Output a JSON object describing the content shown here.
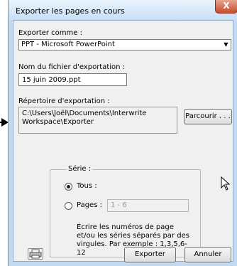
{
  "dialog": {
    "title": "Exporter les pages en cours",
    "close_label": "X"
  },
  "export_as": {
    "label": "Exporter comme :",
    "selected": "PPT - Microsoft PowerPoint"
  },
  "filename": {
    "label": "Nom du fichier d'exportation :",
    "value": "15 juin 2009.ppt"
  },
  "directory": {
    "label": "Répertoire d'exportation :",
    "value": "C:\\Users\\Joël\\Documents\\Interwrite\nWorkspace\\Exporter",
    "browse_label": "Parcourir . . ."
  },
  "series": {
    "group_label": "Série :",
    "all_label": "Tous :",
    "pages_label": "Pages :",
    "pages_value": "1 - 6",
    "help_text": "Écrire les numéros de page et/ou les séries séparés par des virgules. Par exemple : 1,3,5,6-12",
    "selected": "all"
  },
  "footer": {
    "export_label": "Exporter",
    "cancel_label": "Annuler"
  },
  "icons": {
    "printer": "printer-icon",
    "dropdown": "chevron-down-icon",
    "close": "close-icon",
    "cursor": "mouse-cursor-icon",
    "pointer": "arrow-pointer-icon"
  }
}
